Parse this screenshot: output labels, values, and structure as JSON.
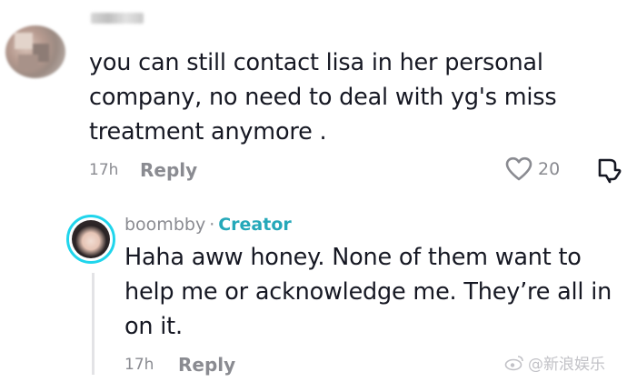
{
  "comment": {
    "text": "you can still contact lisa in her personal company, no need to deal with yg's miss treatment anymore .",
    "time": "17h",
    "reply_label": "Reply",
    "likes": "20"
  },
  "reply": {
    "username": "boombby",
    "separator": "·",
    "creator_badge": "Creator",
    "text": "Haha aww honey. None of them want to help me or acknowledge me. They’re all in on it.",
    "time": "17h",
    "reply_label": "Reply"
  },
  "watermark": {
    "text": "@新浪娱乐",
    "icon": "weibo-icon"
  },
  "colors": {
    "text": "#161823",
    "muted": "#8a8b91",
    "creator_accent": "#25a8b9",
    "avatar_ring": "#20d5ec"
  },
  "icons": [
    "heart-outline-icon",
    "dislike-icon",
    "weibo-icon"
  ]
}
